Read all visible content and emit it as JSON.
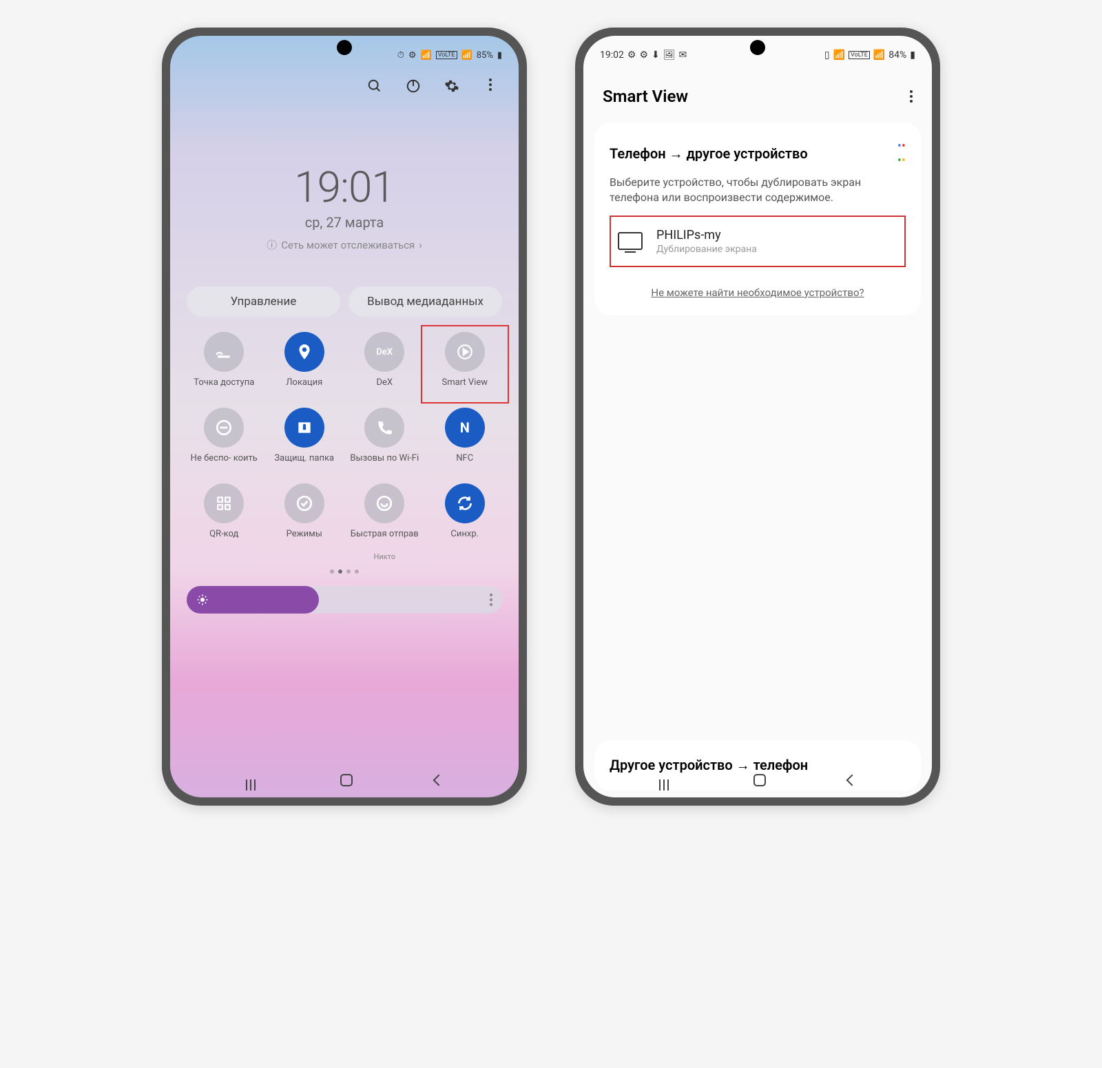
{
  "phone1": {
    "status": {
      "battery": "85%"
    },
    "clock": {
      "time": "19:01",
      "date": "ср, 27 марта",
      "network": "Сеть может отслеживаться"
    },
    "tabs": {
      "manage": "Управление",
      "media": "Вывод медиаданных"
    },
    "tiles": [
      {
        "label": "Точка доступа",
        "on": false,
        "icon": "hotspot"
      },
      {
        "label": "Локация",
        "on": true,
        "icon": "location"
      },
      {
        "label": "DeX",
        "on": false,
        "icon": "dex"
      },
      {
        "label": "Smart View",
        "on": false,
        "icon": "smartview",
        "highlight": true
      },
      {
        "label": "Не беспо-\nкоить",
        "on": false,
        "icon": "dnd"
      },
      {
        "label": "Защищ. папка",
        "on": true,
        "icon": "secure"
      },
      {
        "label": "Вызовы по Wi-Fi",
        "on": false,
        "icon": "wificall"
      },
      {
        "label": "NFC",
        "on": true,
        "icon": "nfc"
      },
      {
        "label": "QR-код",
        "on": false,
        "icon": "qr"
      },
      {
        "label": "Режимы",
        "on": false,
        "icon": "modes"
      },
      {
        "label": "Быстрая отправ",
        "sub": "Никто",
        "on": false,
        "icon": "quickshare"
      },
      {
        "label": "Синхр.",
        "on": true,
        "icon": "sync"
      }
    ]
  },
  "phone2": {
    "status": {
      "time": "19:02",
      "battery": "84%"
    },
    "header": {
      "title": "Smart View"
    },
    "section": {
      "title": "Телефон → другое устройство",
      "desc": "Выберите устройство, чтобы дублировать экран телефона или воспроизвести содержимое."
    },
    "device": {
      "name": "PHILIPs-my",
      "sub": "Дублирование экрана"
    },
    "help": "Не можете найти необходимое устройство?",
    "bottom": {
      "title": "Другое устройство → телефон"
    }
  }
}
